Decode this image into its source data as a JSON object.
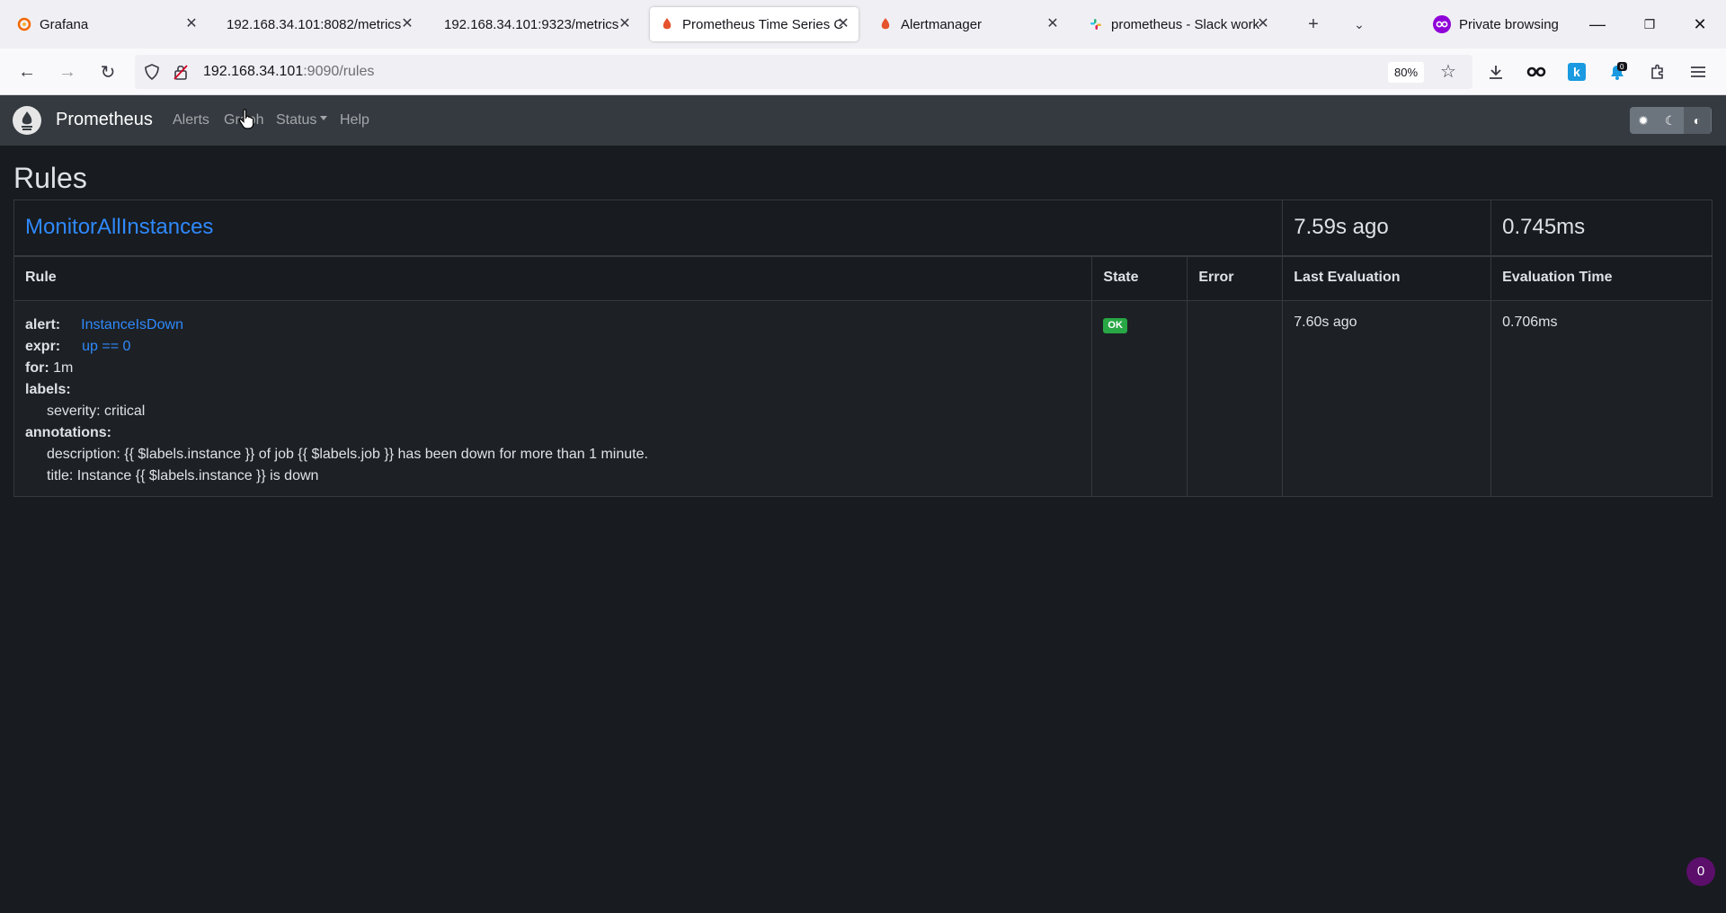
{
  "browser": {
    "tabs": [
      {
        "label": "Grafana",
        "icon": "grafana-icon",
        "active": false
      },
      {
        "label": "192.168.34.101:8082/metrics",
        "icon": "",
        "active": false
      },
      {
        "label": "192.168.34.101:9323/metrics",
        "icon": "",
        "active": false
      },
      {
        "label": "Prometheus Time Series C",
        "icon": "prometheus-icon",
        "active": true
      },
      {
        "label": "Alertmanager",
        "icon": "prometheus-icon",
        "active": false
      },
      {
        "label": "prometheus - Slack work",
        "icon": "slack-icon",
        "active": false
      }
    ],
    "private_label": "Private browsing",
    "url_host": "192.168.34.101",
    "url_rest": ":9090/rules",
    "zoom": "80%",
    "notification_count": "0"
  },
  "prometheus": {
    "brand": "Prometheus",
    "nav": {
      "alerts": "Alerts",
      "graph": "Graph",
      "status": "Status",
      "help": "Help"
    },
    "page_title": "Rules",
    "group": {
      "name": "MonitorAllInstances",
      "last_evaluation": "7.59s ago",
      "evaluation_time": "0.745ms"
    },
    "columns": {
      "rule": "Rule",
      "state": "State",
      "error": "Error",
      "last_evaluation": "Last Evaluation",
      "evaluation_time": "Evaluation Time"
    },
    "rule": {
      "alert_key": "alert:",
      "alert_value": "InstanceIsDown",
      "expr_key": "expr:",
      "expr_value": "up == 0",
      "for_key": "for:",
      "for_value": "1m",
      "labels_key": "labels:",
      "label_severity": "severity: critical",
      "annotations_key": "annotations:",
      "annotation_description": "description: {{ $labels.instance }} of job {{ $labels.job }} has been down for more than 1 minute.",
      "annotation_title": "title: Instance {{ $labels.instance }} is down",
      "state": "OK",
      "error": "",
      "last_evaluation": "7.60s ago",
      "evaluation_time": "0.706ms"
    },
    "corner_badge": "0"
  },
  "colors": {
    "page_bg": "#181b1f",
    "navbar_bg": "#343a40",
    "link": "#2f89fc",
    "ok_badge": "#28a745"
  }
}
